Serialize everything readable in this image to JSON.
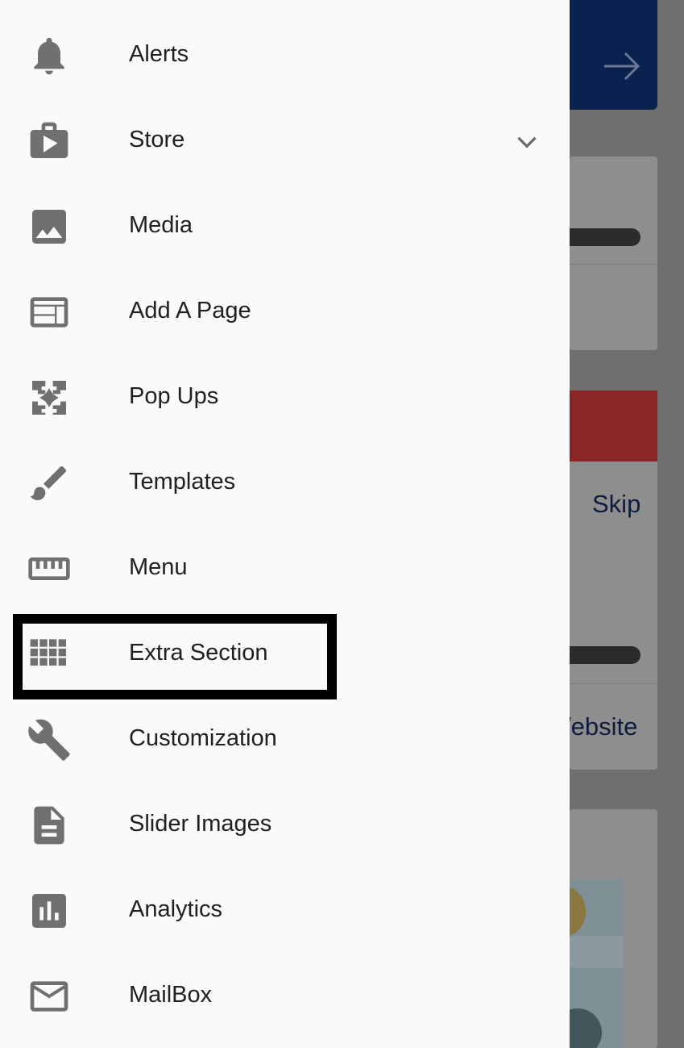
{
  "background": {
    "skip_label": "Skip",
    "website_label": "/ebsite"
  },
  "drawer": {
    "items": [
      {
        "label": "Alerts",
        "icon": "bell-icon"
      },
      {
        "label": "Store",
        "icon": "store-icon"
      },
      {
        "label": "Media",
        "icon": "image-icon"
      },
      {
        "label": "Add A Page",
        "icon": "web-page-icon"
      },
      {
        "label": "Pop Ups",
        "icon": "popup-icon"
      },
      {
        "label": "Templates",
        "icon": "brush-icon"
      },
      {
        "label": "Menu",
        "icon": "ruler-icon"
      },
      {
        "label": "Extra Section",
        "icon": "grid-icon"
      },
      {
        "label": "Customization",
        "icon": "wrench-icon"
      },
      {
        "label": "Slider Images",
        "icon": "document-icon"
      },
      {
        "label": "Analytics",
        "icon": "bar-chart-icon"
      },
      {
        "label": "MailBox",
        "icon": "mail-icon"
      }
    ],
    "expand_icon": "chevron-down-icon",
    "highlighted_item": "Extra Section"
  },
  "colors": {
    "drawer_bg": "#fafafa",
    "icon": "#707070",
    "text": "#202020",
    "highlight_border": "#000000",
    "bg_blue": "#0a2250",
    "bg_red": "#8c2626"
  }
}
